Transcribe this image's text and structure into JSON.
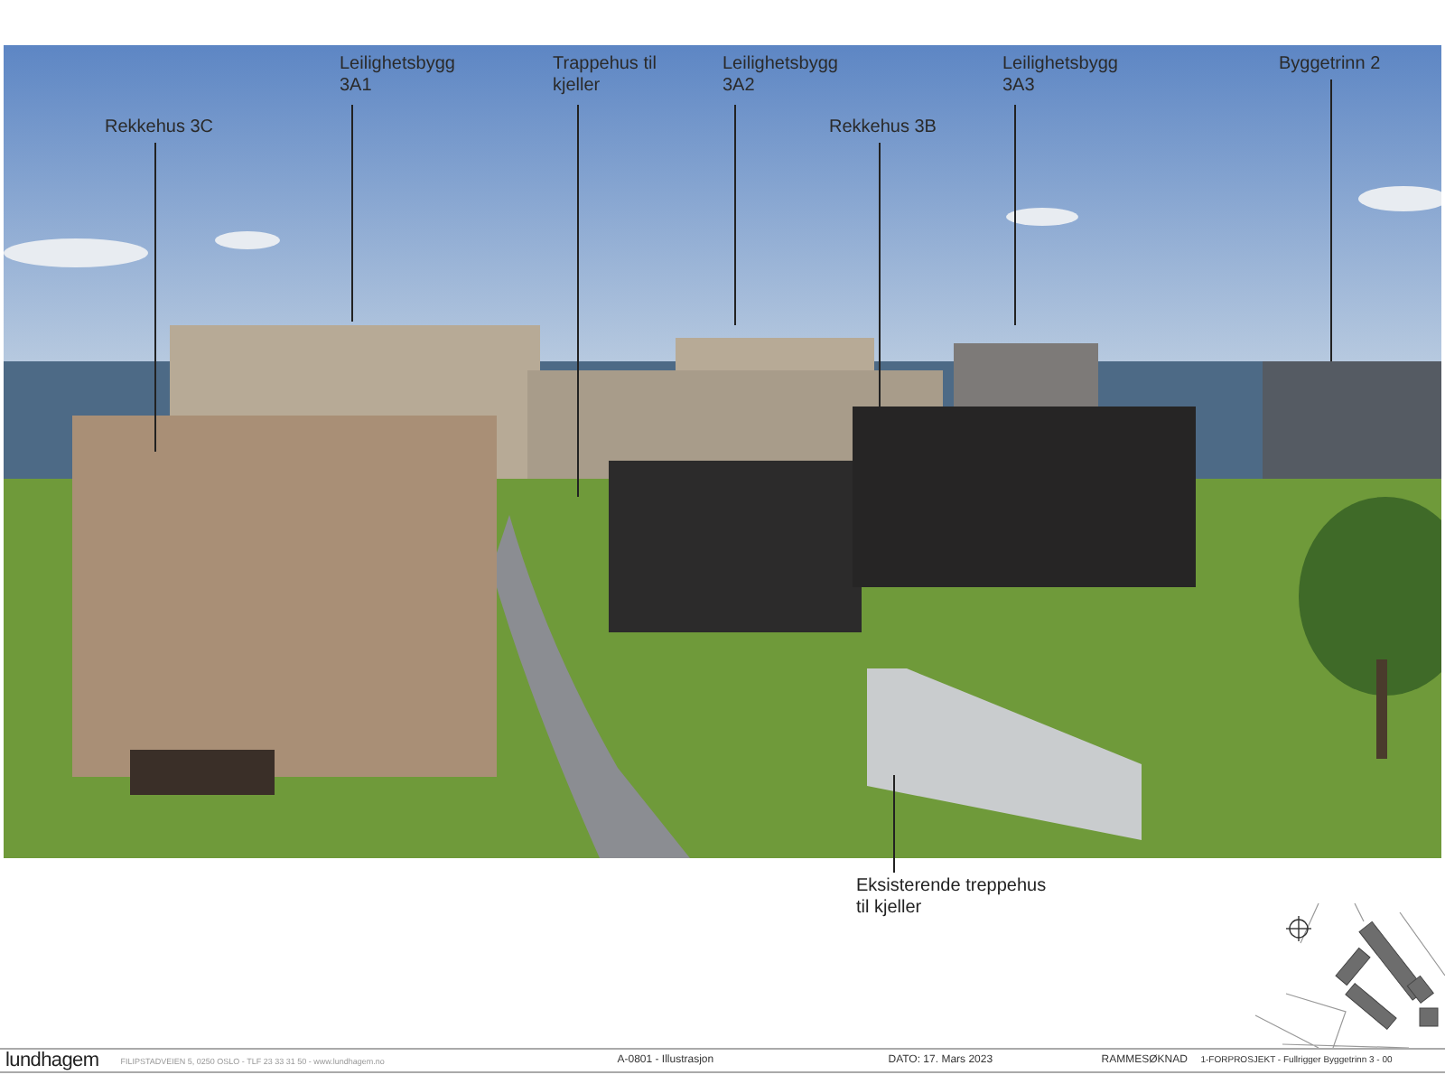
{
  "rendering": {
    "labels": [
      {
        "text": "Rekkehus 3C"
      },
      {
        "text": "Leilighetsbygg 3A1"
      },
      {
        "text": "Trappehus til kjeller"
      },
      {
        "text": "Leilighetsbygg 3A2"
      },
      {
        "text": "Rekkehus 3B"
      },
      {
        "text": "Leilighetsbygg 3A3"
      },
      {
        "text": "Byggetrinn 2"
      }
    ]
  },
  "callout": {
    "text": "Eksisterende treppehus til kjeller"
  },
  "title_block": {
    "logo": "lundhagem",
    "address": "FILIPSTADVEIEN 5, 0250 OSLO - TLF 23 33 31 50 - www.lundhagem.no",
    "drawing": "A-0801 - Illustrasjon",
    "date": "DATO: 17. Mars 2023",
    "phase": "RAMMESØKNAD",
    "project": "1-FORPROSJEKT - Fullrigger Byggetrinn 3 - 00"
  }
}
